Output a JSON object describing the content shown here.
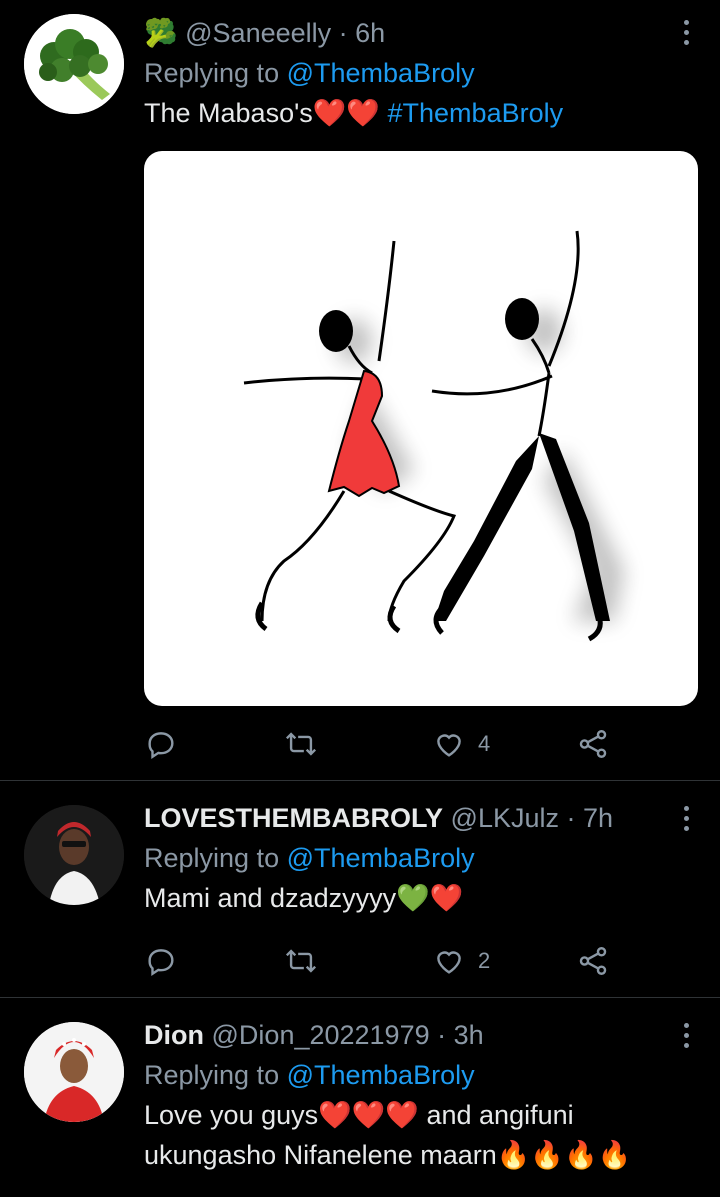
{
  "tweets": [
    {
      "emoji": "🥦",
      "name": "",
      "handle": "@Saneeelly",
      "time": "· 6h",
      "replying_prefix": "Replying to",
      "replying_to": "@ThembaBroly",
      "text": "The Mabaso's",
      "text_emoji": "❤️❤️",
      "hashtag": "#ThembaBroly",
      "likes": "4"
    },
    {
      "name": "LOVESTHEMBABROLY",
      "handle": "@LKJulz",
      "time": "· 7h",
      "replying_prefix": "Replying to",
      "replying_to": "@ThembaBroly",
      "text": "Mami and dzadzyyyy",
      "text_emoji": "💚❤️",
      "likes": "2"
    },
    {
      "name": "Dion",
      "handle": "@Dion_20221979",
      "time": "· 3h",
      "replying_prefix": "Replying to",
      "replying_to": "@ThembaBroly",
      "text": "Love you guys",
      "text_emoji": "❤️❤️❤️",
      "text_after": " and angifuni",
      "text_line2": "ukungasho Nifanelene maarn",
      "text_line2_emoji": "🔥🔥🔥🔥"
    }
  ],
  "colors": {
    "link": "#1d9bf0",
    "muted": "#8b98a5",
    "background": "#000000",
    "dress": "#f03a3a"
  },
  "icons": [
    "reply-icon",
    "retweet-icon",
    "like-icon",
    "share-icon",
    "more-icon"
  ]
}
